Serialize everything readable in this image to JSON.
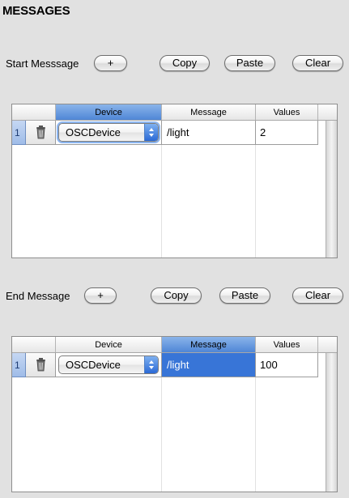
{
  "page": {
    "title": "MESSAGES"
  },
  "start": {
    "label": "Start Messsage",
    "add_label": "+",
    "copy_label": "Copy",
    "paste_label": "Paste",
    "clear_label": "Clear",
    "table": {
      "columns": {
        "device": "Device",
        "message": "Message",
        "values": "Values"
      },
      "selected_column": "Device",
      "rows": [
        {
          "index": "1",
          "device": "OSCDevice",
          "message": "/light",
          "values": "2"
        }
      ]
    }
  },
  "end": {
    "label": "End Message",
    "add_label": "+",
    "copy_label": "Copy",
    "paste_label": "Paste",
    "clear_label": "Clear",
    "table": {
      "columns": {
        "device": "Device",
        "message": "Message",
        "values": "Values"
      },
      "selected_column": "Message",
      "rows": [
        {
          "index": "1",
          "device": "OSCDevice",
          "message": "/light",
          "values": "100"
        }
      ]
    }
  },
  "icons": {
    "delete": "trash-icon",
    "popup": "popup-arrows-icon"
  },
  "colors": {
    "selection": "#3875d7",
    "background": "#e1e1e1"
  }
}
